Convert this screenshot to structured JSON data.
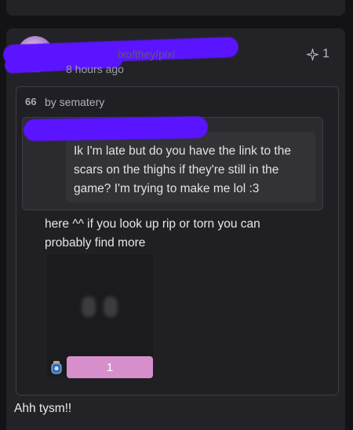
{
  "post": {
    "handle_suffix": "ixo/they/pixi",
    "timestamp": "8 hours ago",
    "star_count": "1",
    "quote": {
      "mark": "66",
      "by": "by sematery",
      "text": "Ik I'm late but do you have the link to the scars on the thighs if they're still in the game? I'm trying to make me lol :3"
    },
    "body": "here ^^ if you look up rip or torn you can probably find more",
    "attachment_button_label": "1",
    "footer": "Ahh tysm!!"
  },
  "colors": {
    "background": "#131316",
    "card": "#232327",
    "pink": "#d78fcc",
    "censor": "#5a14ff"
  },
  "icons": [
    "star-icon",
    "jar-icon"
  ]
}
